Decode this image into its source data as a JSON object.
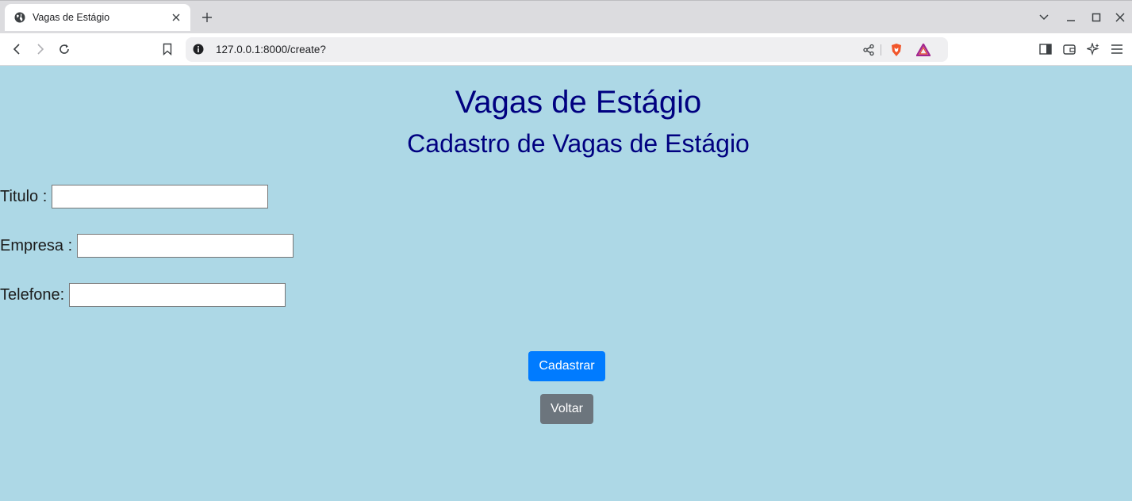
{
  "browser": {
    "tab_title": "Vagas de Estágio",
    "url": "127.0.0.1:8000/create?"
  },
  "page": {
    "heading": "Vagas de Estágio",
    "subheading": "Cadastro de Vagas de Estágio",
    "form": {
      "fields": [
        {
          "label": "Titulo :",
          "value": ""
        },
        {
          "label": "Empresa :",
          "value": ""
        },
        {
          "label": "Telefone:",
          "value": ""
        }
      ],
      "submit_label": "Cadastrar",
      "back_label": "Voltar"
    }
  },
  "colors": {
    "page_background": "#add8e6",
    "heading": "#000080",
    "primary_button": "#007bff",
    "secondary_button": "#6c757d"
  }
}
